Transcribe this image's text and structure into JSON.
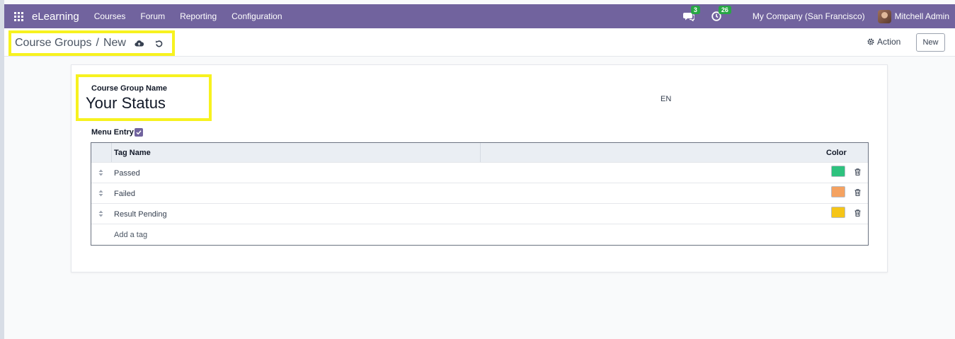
{
  "navbar": {
    "brand": "eLearning",
    "menu": [
      "Courses",
      "Forum",
      "Reporting",
      "Configuration"
    ],
    "messages_count": "3",
    "activities_count": "26",
    "company": "My Company (San Francisco)",
    "user": "Mitchell Admin"
  },
  "control": {
    "breadcrumb_parent": "Course Groups",
    "breadcrumb_sep": "/",
    "breadcrumb_current": "New",
    "action_label": "Action",
    "new_label": "New"
  },
  "form": {
    "name_label": "Course Group Name",
    "name_value": "Your Status",
    "lang": "EN",
    "menu_entry_label": "Menu Entry",
    "menu_entry_checked": true
  },
  "table": {
    "headers": {
      "name": "Tag Name",
      "color": "Color"
    },
    "rows": [
      {
        "name": "Passed",
        "color": "#2ec27e"
      },
      {
        "name": "Failed",
        "color": "#f4a261"
      },
      {
        "name": "Result Pending",
        "color": "#f5c518"
      }
    ],
    "add_label": "Add a tag"
  },
  "colors": {
    "navbar": "#71639e",
    "highlight": "#f7f21f",
    "badge": "#28a745"
  }
}
